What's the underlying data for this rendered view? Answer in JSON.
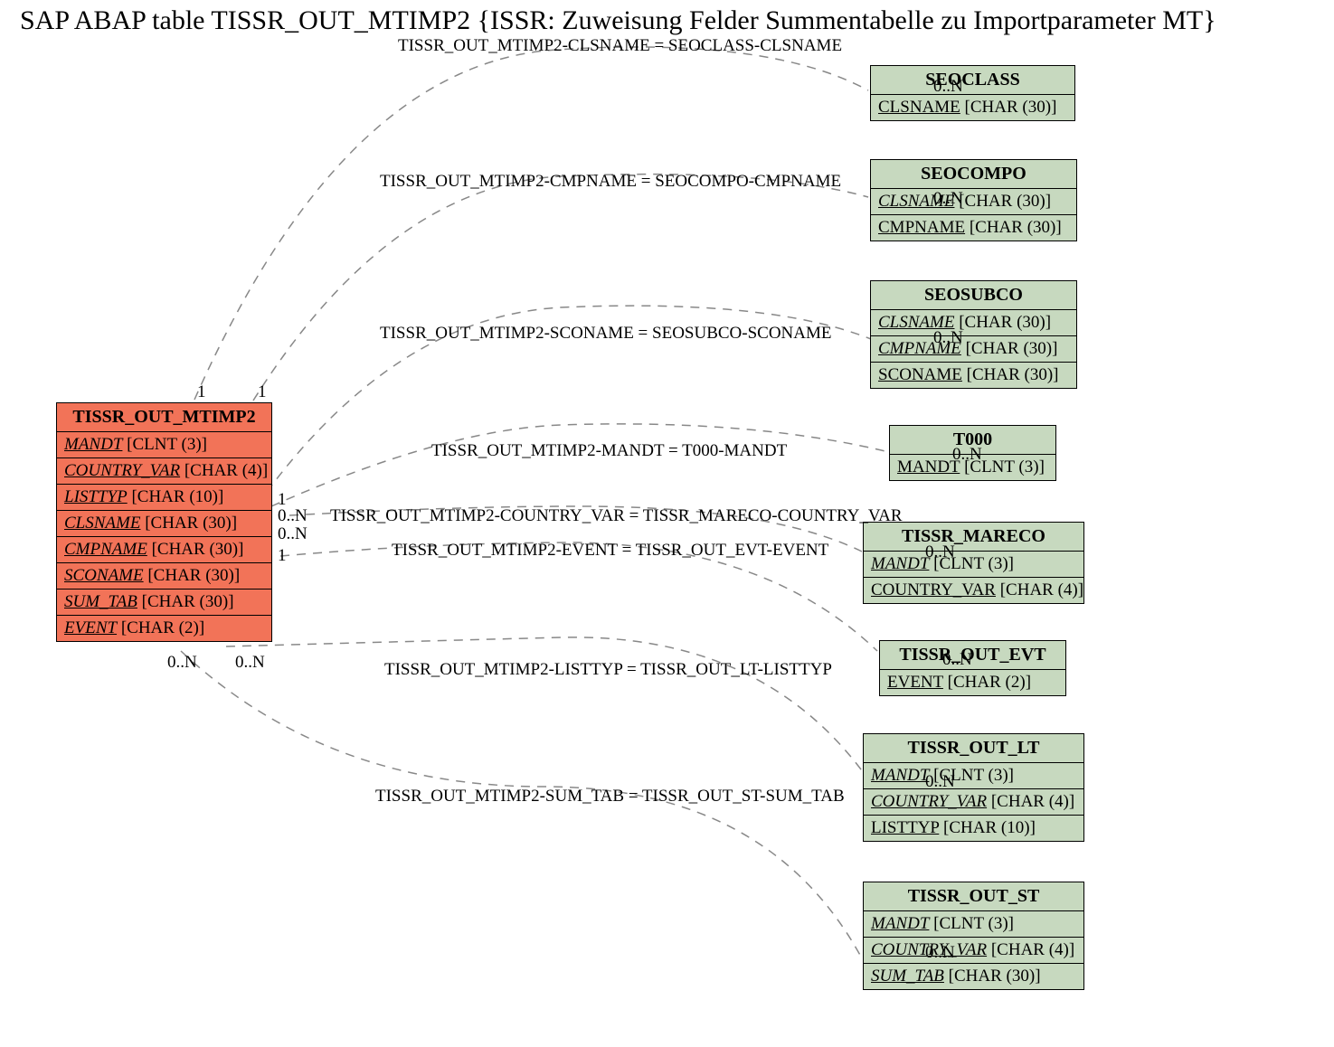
{
  "title": "SAP ABAP table TISSR_OUT_MTIMP2 {ISSR: Zuweisung Felder Summentabelle zu Importparameter MT}",
  "main_entity": {
    "name": "TISSR_OUT_MTIMP2",
    "fields": [
      {
        "name": "MANDT",
        "type": "[CLNT (3)]"
      },
      {
        "name": "COUNTRY_VAR",
        "type": "[CHAR (4)]"
      },
      {
        "name": "LISTTYP",
        "type": "[CHAR (10)]"
      },
      {
        "name": "CLSNAME",
        "type": "[CHAR (30)]"
      },
      {
        "name": "CMPNAME",
        "type": "[CHAR (30)]"
      },
      {
        "name": "SCONAME",
        "type": "[CHAR (30)]"
      },
      {
        "name": "SUM_TAB",
        "type": "[CHAR (30)]"
      },
      {
        "name": "EVENT",
        "type": "[CHAR (2)]"
      }
    ]
  },
  "related_entities": {
    "seoclass": {
      "name": "SEOCLASS",
      "fields": [
        {
          "name": "CLSNAME",
          "type": "[CHAR (30)]",
          "ital": false
        }
      ]
    },
    "seocompo": {
      "name": "SEOCOMPO",
      "fields": [
        {
          "name": "CLSNAME",
          "type": "[CHAR (30)]",
          "ital": true
        },
        {
          "name": "CMPNAME",
          "type": "[CHAR (30)]",
          "ital": false
        }
      ]
    },
    "seosubco": {
      "name": "SEOSUBCO",
      "fields": [
        {
          "name": "CLSNAME",
          "type": "[CHAR (30)]",
          "ital": true
        },
        {
          "name": "CMPNAME",
          "type": "[CHAR (30)]",
          "ital": true
        },
        {
          "name": "SCONAME",
          "type": "[CHAR (30)]",
          "ital": false
        }
      ]
    },
    "t000": {
      "name": "T000",
      "fields": [
        {
          "name": "MANDT",
          "type": "[CLNT (3)]",
          "ital": false
        }
      ]
    },
    "tissr_mareco": {
      "name": "TISSR_MARECO",
      "fields": [
        {
          "name": "MANDT",
          "type": "[CLNT (3)]",
          "ital": true
        },
        {
          "name": "COUNTRY_VAR",
          "type": "[CHAR (4)]",
          "ital": false
        }
      ]
    },
    "tissr_out_evt": {
      "name": "TISSR_OUT_EVT",
      "fields": [
        {
          "name": "EVENT",
          "type": "[CHAR (2)]",
          "ital": false
        }
      ]
    },
    "tissr_out_lt": {
      "name": "TISSR_OUT_LT",
      "fields": [
        {
          "name": "MANDT",
          "type": "[CLNT (3)]",
          "ital": true
        },
        {
          "name": "COUNTRY_VAR",
          "type": "[CHAR (4)]",
          "ital": true
        },
        {
          "name": "LISTTYP",
          "type": "[CHAR (10)]",
          "ital": false
        }
      ]
    },
    "tissr_out_st": {
      "name": "TISSR_OUT_ST",
      "fields": [
        {
          "name": "MANDT",
          "type": "[CLNT (3)]",
          "ital": true
        },
        {
          "name": "COUNTRY_VAR",
          "type": "[CHAR (4)]",
          "ital": true
        },
        {
          "name": "SUM_TAB",
          "type": "[CHAR (30)]",
          "ital": true
        }
      ]
    }
  },
  "relations": {
    "r0": "TISSR_OUT_MTIMP2-CLSNAME = SEOCLASS-CLSNAME",
    "r1": "TISSR_OUT_MTIMP2-CMPNAME = SEOCOMPO-CMPNAME",
    "r2": "TISSR_OUT_MTIMP2-SCONAME = SEOSUBCO-SCONAME",
    "r3": "TISSR_OUT_MTIMP2-MANDT = T000-MANDT",
    "r4": "TISSR_OUT_MTIMP2-COUNTRY_VAR = TISSR_MARECO-COUNTRY_VAR",
    "r5": "TISSR_OUT_MTIMP2-EVENT = TISSR_OUT_EVT-EVENT",
    "r6": "TISSR_OUT_MTIMP2-LISTTYP = TISSR_OUT_LT-LISTTYP",
    "r7": "TISSR_OUT_MTIMP2-SUM_TAB = TISSR_OUT_ST-SUM_TAB"
  },
  "cardinalities": {
    "c_main_top1": "1",
    "c_main_top2": "1",
    "c_main_mid1": "1",
    "c_main_mid_n1": "0..N",
    "c_main_mid_n2": "0..N",
    "c_main_mid2": "1",
    "c_main_bot1": "0..N",
    "c_main_bot2": "0..N",
    "c_seoclass": "0..N",
    "c_seocompo": "0..N",
    "c_seosubco": "0..N",
    "c_t000": "0..N",
    "c_mareco": "0..N",
    "c_evt": "0..N",
    "c_lt": "0..N",
    "c_st": "0..N"
  }
}
